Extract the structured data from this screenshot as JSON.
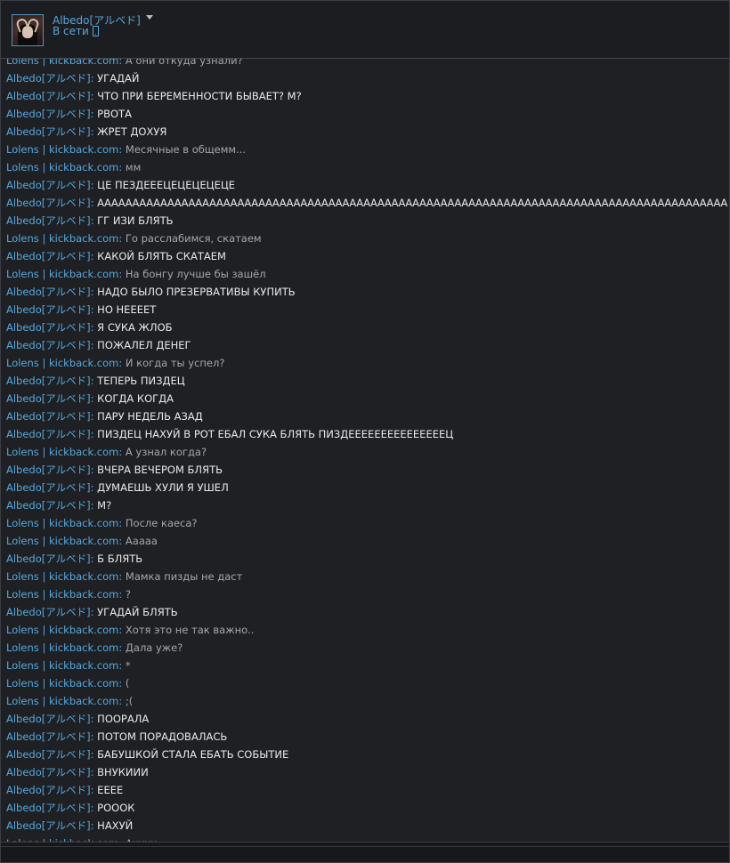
{
  "header": {
    "name": "Albedo[アルベド]",
    "status": "В сети"
  },
  "messages": [
    {
      "author": "Lolens | kickback.com",
      "role": "lolens",
      "text": "А они откуда узнали?"
    },
    {
      "author": "Albedo[アルベド]",
      "role": "albedo",
      "text": "УГАДАЙ"
    },
    {
      "author": "Albedo[アルベド]",
      "role": "albedo",
      "text": "ЧТО ПРИ БЕРЕМЕННОСТИ БЫВАЕТ? М?"
    },
    {
      "author": "Albedo[アルベド]",
      "role": "albedo",
      "text": "РВОТА"
    },
    {
      "author": "Albedo[アルベド]",
      "role": "albedo",
      "text": "ЖРЕТ ДОХУЯ"
    },
    {
      "author": "Lolens | kickback.com",
      "role": "lolens",
      "text": "Месячные в общемм..."
    },
    {
      "author": "Lolens | kickback.com",
      "role": "lolens",
      "text": "мм"
    },
    {
      "author": "Albedo[アルベド]",
      "role": "albedo",
      "text": "ЦЕ ПЕЗДЕЕЕЦЕЦЕЦЕЦЕЦЕ"
    },
    {
      "author": "Albedo[アルベド]",
      "role": "albedo",
      "text": "АААААААААААААААААААААААААААААААААААААААААААААААААААААААААААААААААААААААААААААААААААААААААААААААААААА"
    },
    {
      "author": "Albedo[アルベド]",
      "role": "albedo",
      "text": "ГГ ИЗИ БЛЯТЬ"
    },
    {
      "author": "Lolens | kickback.com",
      "role": "lolens",
      "text": "Го расслабимся, скатаем"
    },
    {
      "author": "Albedo[アルベド]",
      "role": "albedo",
      "text": "КАКОЙ БЛЯТЬ СКАТАЕМ"
    },
    {
      "author": "Lolens | kickback.com",
      "role": "lolens",
      "text": "На бонгу лучше бы зашёл"
    },
    {
      "author": "Albedo[アルベド]",
      "role": "albedo",
      "text": "НАДО БЫЛО ПРЕЗЕРВАТИВЫ КУПИТЬ"
    },
    {
      "author": "Albedo[アルベド]",
      "role": "albedo",
      "text": "НО НЕЕЕЕТ"
    },
    {
      "author": "Albedo[アルベド]",
      "role": "albedo",
      "text": "Я СУКА ЖЛОБ"
    },
    {
      "author": "Albedo[アルベド]",
      "role": "albedo",
      "text": "ПОЖАЛЕЛ ДЕНЕГ"
    },
    {
      "author": "Lolens | kickback.com",
      "role": "lolens",
      "text": "И когда ты успел?"
    },
    {
      "author": "Albedo[アルベド]",
      "role": "albedo",
      "text": "ТЕПЕРЬ ПИЗДЕЦ"
    },
    {
      "author": "Albedo[アルベド]",
      "role": "albedo",
      "text": "КОГДА КОГДА"
    },
    {
      "author": "Albedo[アルベド]",
      "role": "albedo",
      "text": "ПАРУ НЕДЕЛЬ АЗАД"
    },
    {
      "author": "Albedo[アルベド]",
      "role": "albedo",
      "text": "ПИЗДЕЦ НАХУЙ В РОТ ЕБАЛ СУКА БЛЯТЬ ПИЗДЕЕЕЕЕЕЕЕЕЕЕЕЕЕЕЦ"
    },
    {
      "author": "Lolens | kickback.com",
      "role": "lolens",
      "text": "А узнал когда?"
    },
    {
      "author": "Albedo[アルベド]",
      "role": "albedo",
      "text": "ВЧЕРА ВЕЧЕРОМ БЛЯТЬ"
    },
    {
      "author": "Albedo[アルベド]",
      "role": "albedo",
      "text": "ДУМАЕШЬ ХУЛИ Я УШЕЛ"
    },
    {
      "author": "Albedo[アルベド]",
      "role": "albedo",
      "text": "М?"
    },
    {
      "author": "Lolens | kickback.com",
      "role": "lolens",
      "text": "После каеса?"
    },
    {
      "author": "Lolens | kickback.com",
      "role": "lolens",
      "text": "Ааааа"
    },
    {
      "author": "Albedo[アルベド]",
      "role": "albedo",
      "text": "Б БЛЯТЬ"
    },
    {
      "author": "Lolens | kickback.com",
      "role": "lolens",
      "text": "Мамка пизды не даст"
    },
    {
      "author": "Lolens | kickback.com",
      "role": "lolens",
      "text": "?"
    },
    {
      "author": "Albedo[アルベド]",
      "role": "albedo",
      "text": "УГАДАЙ БЛЯТЬ"
    },
    {
      "author": "Lolens | kickback.com",
      "role": "lolens",
      "text": "Хотя это не так важно.."
    },
    {
      "author": "Lolens | kickback.com",
      "role": "lolens",
      "text": "Дала уже?"
    },
    {
      "author": "Lolens | kickback.com",
      "role": "lolens",
      "text": "*"
    },
    {
      "author": "Lolens | kickback.com",
      "role": "lolens",
      "text": "("
    },
    {
      "author": "Lolens | kickback.com",
      "role": "lolens",
      "text": ";("
    },
    {
      "author": "Albedo[アルベド]",
      "role": "albedo",
      "text": "ПООРАЛА"
    },
    {
      "author": "Albedo[アルベド]",
      "role": "albedo",
      "text": "ПОТОМ ПОРАДОВАЛАСЬ"
    },
    {
      "author": "Albedo[アルベド]",
      "role": "albedo",
      "text": "БАБУШКОЙ СТАЛА ЕБАТЬ СОБЫТИЕ"
    },
    {
      "author": "Albedo[アルベド]",
      "role": "albedo",
      "text": "ВНУКИИИ"
    },
    {
      "author": "Albedo[アルベド]",
      "role": "albedo",
      "text": "ЕЕЕЕ"
    },
    {
      "author": "Albedo[アルベド]",
      "role": "albedo",
      "text": "РОООК"
    },
    {
      "author": "Albedo[アルベド]",
      "role": "albedo",
      "text": "НАХУЙ"
    },
    {
      "author": "Lolens | kickback.com",
      "role": "lolens",
      "text": "Ахххх"
    }
  ]
}
